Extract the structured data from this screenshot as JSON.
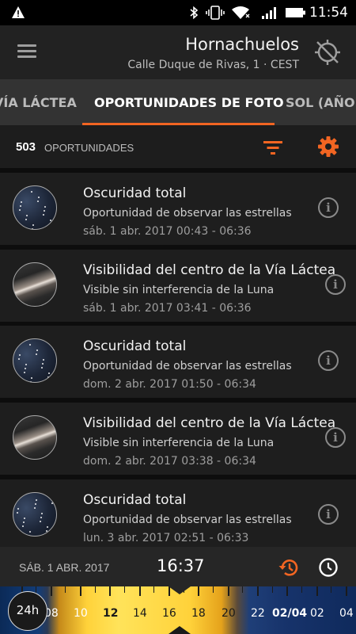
{
  "status": {
    "time": "11:54"
  },
  "header": {
    "title": "Hornachuelos",
    "subtitle": "Calle Duque de Rivas, 1  ·  CEST"
  },
  "tabs": [
    {
      "label": "VÍA LÁCTEA",
      "active": false
    },
    {
      "label": "OPORTUNIDADES DE FOTO",
      "active": true
    },
    {
      "label": "SOL (AÑO)",
      "active": false
    }
  ],
  "summary": {
    "count": "503",
    "label": "OPORTUNIDADES"
  },
  "cards": [
    {
      "kind": "stars",
      "title": "Oscuridad total",
      "subtitle": "Oportunidad de observar las estrellas",
      "date": "sáb.  1 abr. 2017 00:43 - 06:36"
    },
    {
      "kind": "milky",
      "title": "Visibilidad del centro de la Vía Láctea",
      "subtitle": "Visible sin interferencia de la Luna",
      "date": "sáb.  1 abr. 2017 03:41 - 06:36"
    },
    {
      "kind": "stars",
      "title": "Oscuridad total",
      "subtitle": "Oportunidad de observar las estrellas",
      "date": "dom.  2 abr. 2017 01:50 - 06:34"
    },
    {
      "kind": "milky",
      "title": "Visibilidad del centro de la Vía Láctea",
      "subtitle": "Visible sin interferencia de la Luna",
      "date": "dom.  2 abr. 2017 03:38 - 06:34"
    },
    {
      "kind": "stars",
      "title": "Oscuridad total",
      "subtitle": "Oportunidad de observar las estrellas",
      "date": "lun.  3 abr. 2017 02:51 - 06:33"
    }
  ],
  "bottom": {
    "date": "SÁB.  1 ABR. 2017",
    "time": "16:37"
  },
  "timeline": {
    "button_label": "24h",
    "labels": [
      "08",
      "10",
      "12",
      "14",
      "16",
      "18",
      "20",
      "22",
      "02/04",
      "02",
      "04"
    ]
  },
  "colors": {
    "accent": "#f26522"
  }
}
